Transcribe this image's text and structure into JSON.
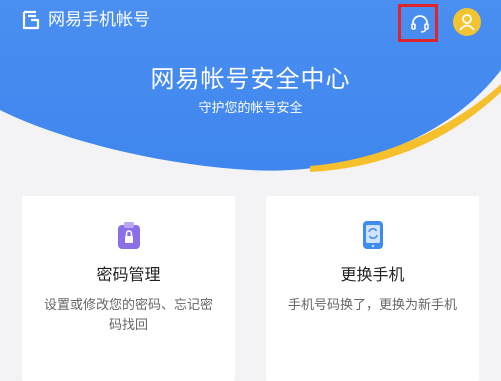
{
  "header": {
    "app_title": "网易手机帐号",
    "logo_icon": "netease-logo-icon",
    "support_icon": "headset-icon",
    "avatar_icon": "user-icon"
  },
  "hero": {
    "title": "网易帐号安全中心",
    "subtitle": "守护您的帐号安全"
  },
  "cards": [
    {
      "title": "密码管理",
      "description": "设置或修改您的密码、忘记密码找回",
      "icon": "password-clipboard-icon"
    },
    {
      "title": "更换手机",
      "description": "手机号码换了，更换为新手机",
      "icon": "phone-swap-icon"
    }
  ],
  "colors": {
    "brand_blue": "#4a8ef0",
    "accent_yellow": "#f6c02c",
    "highlight_red": "#e0242b",
    "avatar_yellow": "#f3c432",
    "password_purple": "#8a6fe8",
    "phone_blue": "#3f8cf0"
  }
}
